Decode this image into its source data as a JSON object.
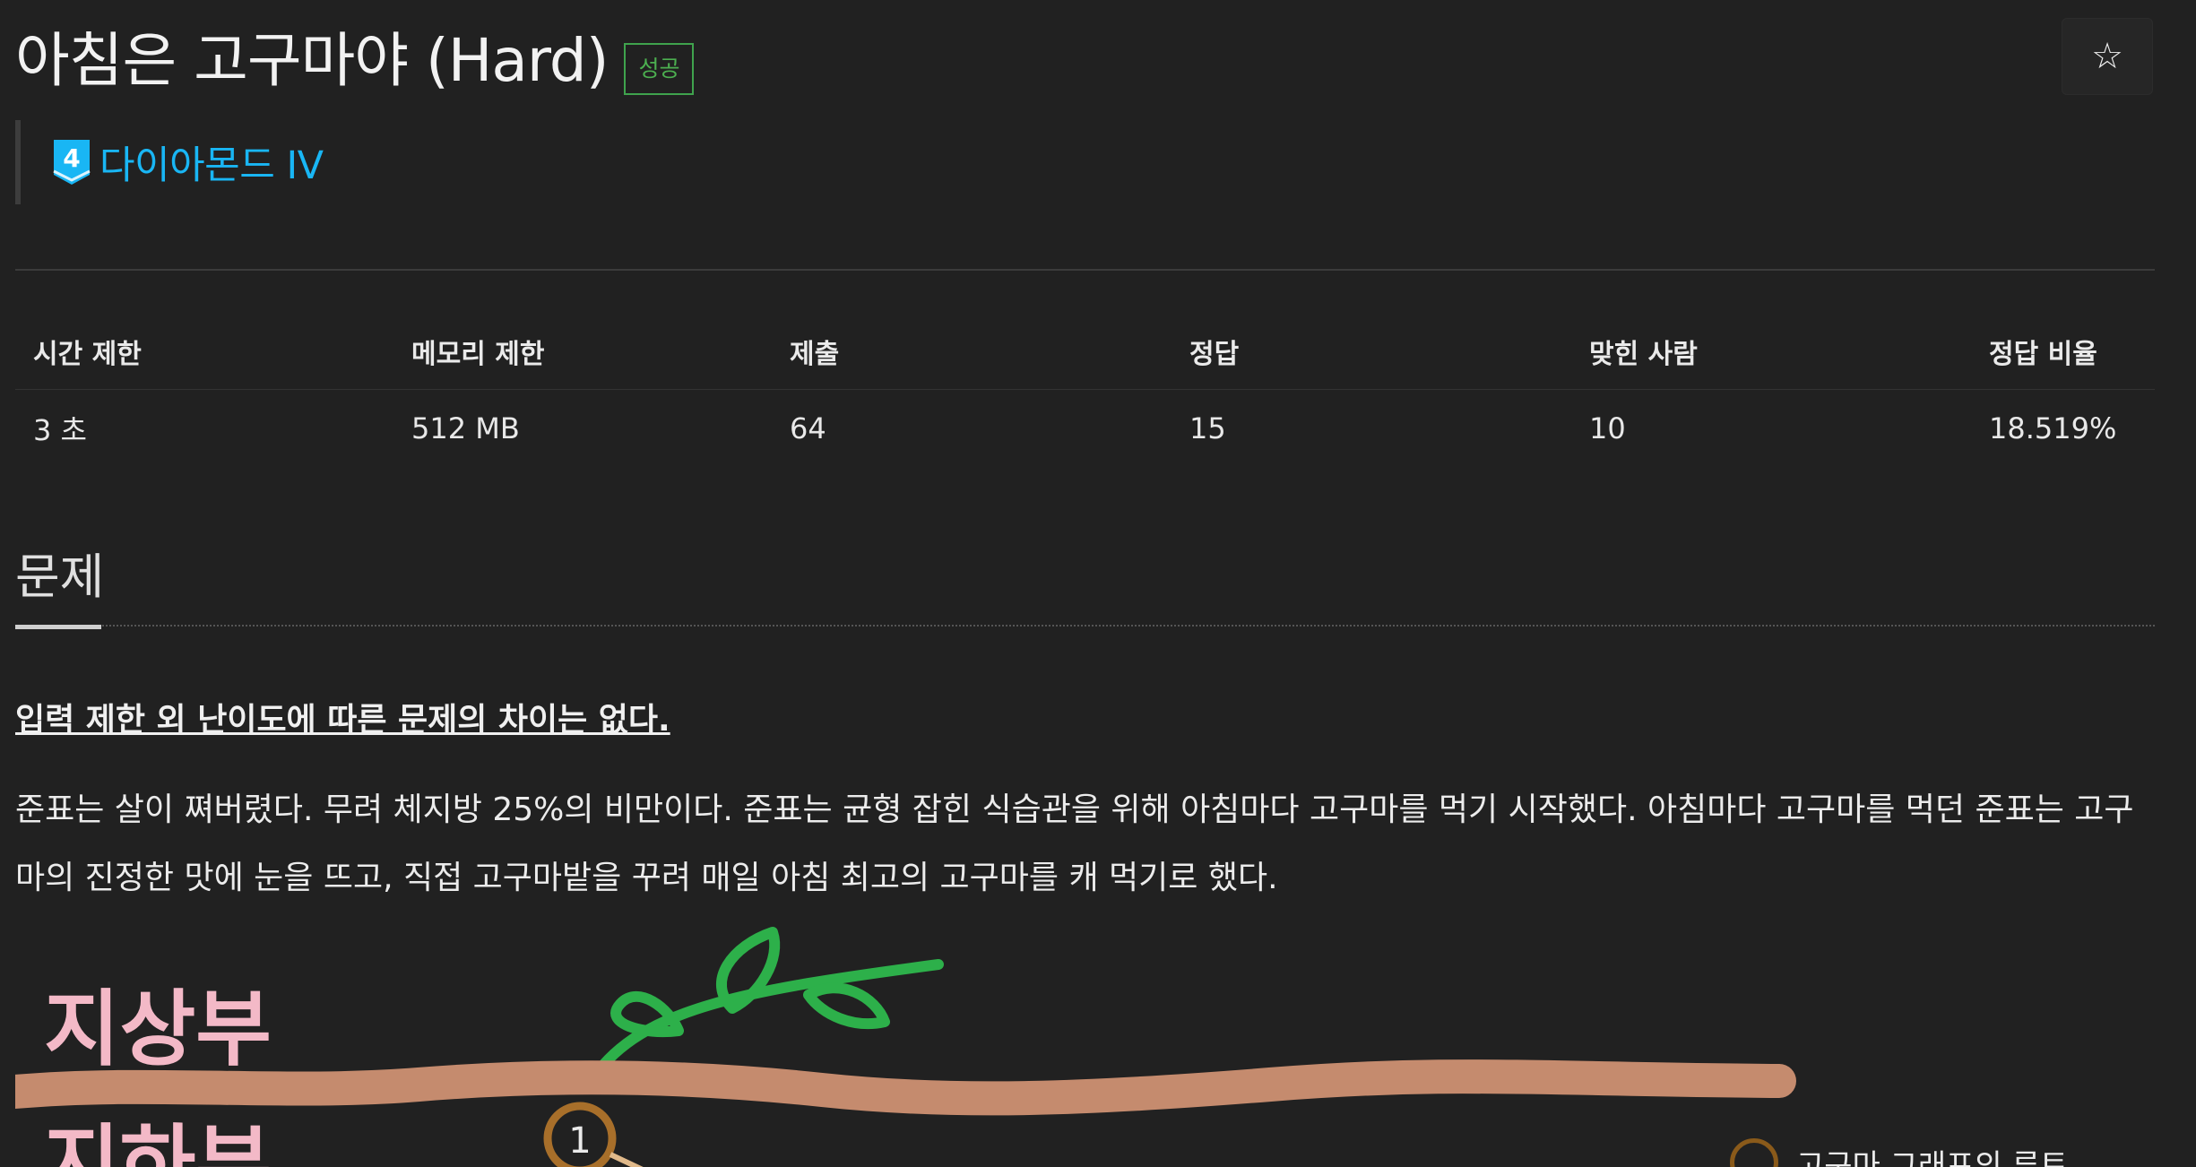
{
  "title": "아침은 고구마야 (Hard)",
  "badge": "성공",
  "favorite_icon": "☆",
  "tier": {
    "number": "4",
    "label": "다이아몬드 IV",
    "color": "#19b6f4"
  },
  "info_table": {
    "headers": [
      "시간 제한",
      "메모리 제한",
      "제출",
      "정답",
      "맞힌 사람",
      "정답 비율"
    ],
    "values": [
      "3 초",
      "512 MB",
      "64",
      "15",
      "10",
      "18.519%"
    ]
  },
  "section": {
    "title": "문제"
  },
  "problem": {
    "note": "입력 제한 외 난이도에 따른 문제의 차이는 없다.",
    "description": "준표는 살이 쪄버렸다. 무려 체지방 25%의 비만이다. 준표는 균형 잡힌 식습관을 위해 아침마다 고구마를 먹기 시작했다. 아침마다 고구마를 먹던 준표는 고구마의 진정한 맛에 눈을 뜨고, 직접 고구마밭을 꾸려 매일 아침 최고의 고구마를 캐 먹기로 했다."
  },
  "illustration": {
    "label_top": "지상부",
    "label_bottom": "지하부",
    "node_label": "1",
    "legend_text": "고구마 그래프의 루트"
  }
}
